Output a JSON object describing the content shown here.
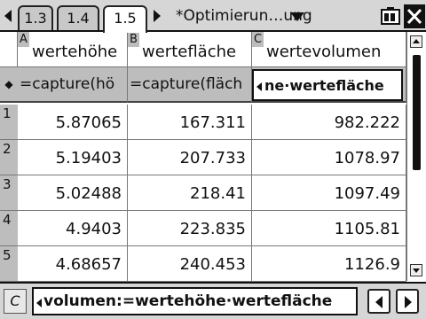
{
  "tabs": [
    {
      "label": "1.3",
      "active": false
    },
    {
      "label": "1.4",
      "active": false
    },
    {
      "label": "1.5",
      "active": true
    }
  ],
  "document": {
    "title": "*Optimierun…ung",
    "dropdown_icon": "triangle-down-icon"
  },
  "status_icons": [
    "battery-icon",
    "close-icon"
  ],
  "columns": [
    {
      "letter": "A",
      "name": "wertehöhe",
      "formula": "=capture(hö"
    },
    {
      "letter": "B",
      "name": "wertefläche",
      "formula": "=capture(fläch"
    },
    {
      "letter": "C",
      "name": "wertevolumen",
      "formula": "ne·wertefläche"
    }
  ],
  "formula_row_marker": "◆",
  "rows": [
    {
      "num": "1",
      "cells": [
        "5.87065",
        "167.311",
        "982.222"
      ]
    },
    {
      "num": "2",
      "cells": [
        "5.19403",
        "207.733",
        "1078.97"
      ]
    },
    {
      "num": "3",
      "cells": [
        "5.02488",
        "218.41",
        "1097.49"
      ]
    },
    {
      "num": "4",
      "cells": [
        "4.9403",
        "223.835",
        "1105.81"
      ]
    },
    {
      "num": "5",
      "cells": [
        "4.68657",
        "240.453",
        "1126.9"
      ]
    }
  ],
  "entry_bar": {
    "cell_ref": "C",
    "text": "volumen:=wertehöhe·wertefläche"
  }
}
